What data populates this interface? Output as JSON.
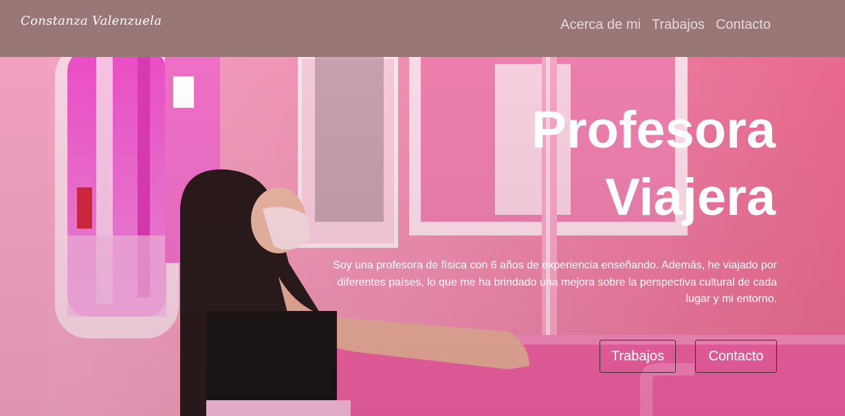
{
  "header": {
    "logo_text": "Constanza Valenzuela",
    "nav": [
      {
        "label": "Acerca de mi"
      },
      {
        "label": "Trabajos"
      },
      {
        "label": "Contacto"
      }
    ]
  },
  "hero": {
    "title_line1": "Profesora",
    "title_line2": "Viajera",
    "description": "Soy una profesora de física con 6 años de experiencia enseñando. Además, he viajado por diferentes países, lo que me ha brindado una mejora sobre la perspectiva cultural de cada lugar y mi entorno.",
    "buttons": [
      {
        "label": "Trabajos"
      },
      {
        "label": "Contacto"
      }
    ]
  },
  "colors": {
    "header_bg": "#9a7777",
    "hero_pink": "#e9749b",
    "accent_magenta": "#e83fbe"
  }
}
